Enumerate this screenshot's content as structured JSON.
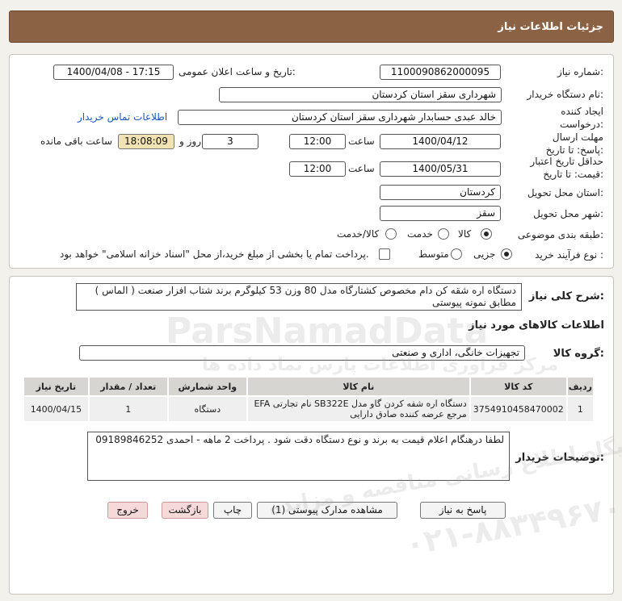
{
  "header": {
    "title": "جزئیات اطلاعات نیاز"
  },
  "form": {
    "need_number_label": "شماره نیاز:",
    "need_number": "1100090862000095",
    "announce_label": "تاریخ و ساعت اعلان عمومی:",
    "announce_value": "1400/04/08 - 17:15",
    "buyer_org_label": "نام دستگاه خریدار:",
    "buyer_org": "شهرداری سقز استان کردستان",
    "creator_label": "ایجاد کننده درخواست:",
    "creator": "خالد عبدی حسابدار شهرداری سقز استان کردستان",
    "contact_link": "اطلاعات تماس خریدار",
    "deadline_label": "مهلت ارسال پاسخ: تا تاریخ:",
    "deadline_date": "1400/04/12",
    "time_label": "ساعت",
    "deadline_time": "12:00",
    "days_value": "3",
    "days_label": "روز و",
    "remaining_time": "18:08:09",
    "remaining_label": "ساعت باقی مانده",
    "validity_label": "حداقل تاریخ اعتبار قیمت: تا تاریخ:",
    "validity_date": "1400/05/31",
    "validity_time": "12:00",
    "province_label": "استان محل تحویل:",
    "province": "کردستان",
    "city_label": "شهر محل تحویل:",
    "city": "سقز",
    "category_label": "طبقه بندی موضوعی:",
    "category_options": [
      "کالا",
      "خدمت",
      "کالا/خدمت"
    ],
    "process_label": "نوع فرآیند خرید :",
    "process_options": [
      "جزیی",
      "متوسط"
    ],
    "process_note": "پرداخت تمام یا بخشی از مبلغ خرید،از محل \"اسناد خزانه اسلامی\" خواهد بود."
  },
  "details": {
    "desc_label": "شرح کلی نیاز:",
    "description": "دستگاه اره شقه کن دام مخصوص کشتارگاه مدل 80 وزن 53 کیلوگرم برند شتاب افزار صنعت ( الماس ) مطابق نمونه پیوستی",
    "items_title": "اطلاعات کالاهای مورد نیاز",
    "group_label": "گروه کالا:",
    "group_value": "تجهیزات خانگی، اداری و صنعتی",
    "table": {
      "headers": [
        "ردیف",
        "کد کالا",
        "نام کالا",
        "واحد شمارش",
        "تعداد / مقدار",
        "تاریخ نیاز"
      ],
      "rows": [
        [
          "1",
          "3754910458470002",
          "دستگاه اره شقه کردن گاو مدل SB322E نام تجارتی EFA مرجع عرضه کننده صادق دارایی",
          "دستگاه",
          "1",
          "1400/04/15"
        ]
      ]
    },
    "buyer_notes_label": "توضیحات خریدار:",
    "buyer_notes": "لطفا درهنگام اعلام قیمت به برند و نوع دستگاه دقت شود . پرداخت 2 ماهه - احمدی 09189846252"
  },
  "buttons": {
    "reply": "پاسخ به نیاز",
    "docs": "مشاهده مدارک پیوستی (1)",
    "print": "چاپ",
    "back": "بازگشت",
    "exit": "خروج"
  },
  "watermark": {
    "brand": "ParsNamadData",
    "line1": "مرکز فراوری اطلاعات پارس نماد داده ها",
    "line2": "پایگاه اطلاع رسانی مناقصه و مزایده",
    "phone": "۰۲۱-۸۸۳۴۹۶۷۰"
  }
}
